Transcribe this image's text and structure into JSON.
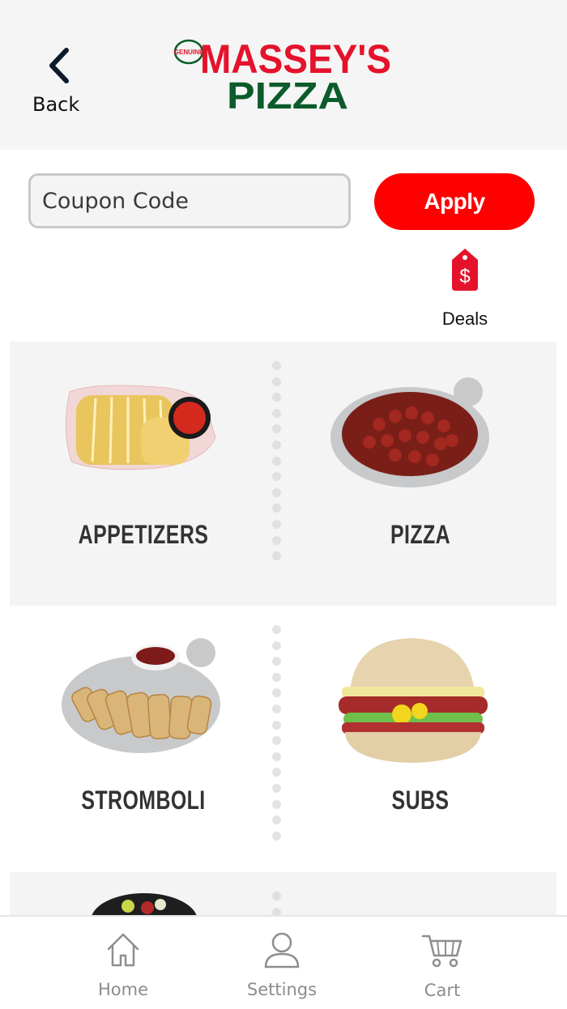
{
  "header": {
    "back_label": "Back",
    "logo": {
      "tag": "GENUINE",
      "line1": "MASSEY'S",
      "line2": "PIZZA"
    }
  },
  "coupon": {
    "placeholder": "Coupon Code",
    "apply_label": "Apply"
  },
  "deals": {
    "label": "Deals",
    "icon": "price-tag-dollar-icon"
  },
  "categories": [
    {
      "label": "APPETIZERS",
      "image": "garlic-bread-photo"
    },
    {
      "label": "PIZZA",
      "image": "pepperoni-pizza-photo"
    },
    {
      "label": "STROMBOLI",
      "image": "stromboli-photo"
    },
    {
      "label": "SUBS",
      "image": "sub-sandwich-photo"
    }
  ],
  "tabbar": {
    "items": [
      {
        "label": "Home",
        "icon": "home-icon"
      },
      {
        "label": "Settings",
        "icon": "person-icon"
      },
      {
        "label": "Cart",
        "icon": "cart-icon"
      }
    ]
  },
  "colors": {
    "brand_red": "#ff0000",
    "logo_red": "#e4132b",
    "logo_green": "#0b5b2b",
    "header_bg": "#f4f5f4"
  }
}
